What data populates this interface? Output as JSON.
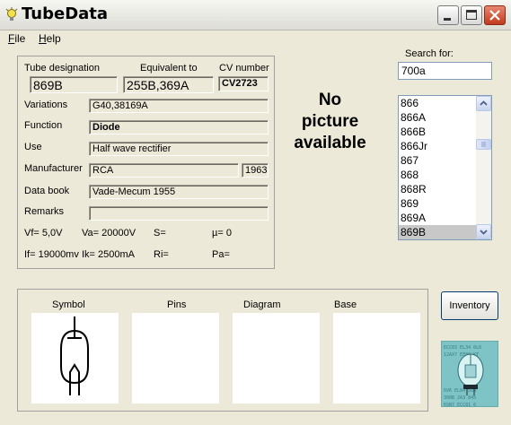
{
  "window": {
    "title": "TubeData"
  },
  "menu": {
    "file": "File",
    "help": "Help"
  },
  "labels": {
    "tube_designation": "Tube designation",
    "equivalent_to": "Equivalent to",
    "cv_number": "CV number",
    "variations": "Variations",
    "function": "Function",
    "use": "Use",
    "manufacturer": "Manufacturer",
    "data_book": "Data book",
    "remarks": "Remarks"
  },
  "fields": {
    "tube_designation": "869B",
    "equivalent_to": "255B,369A",
    "cv_number": "CV2723",
    "variations": "G40,38169A",
    "function": "Diode",
    "use": "Half wave rectifier",
    "manufacturer": "RCA",
    "year": "1963",
    "data_book": "Vade-Mecum 1955",
    "remarks": ""
  },
  "params": {
    "vf": "Vf= 5,0V",
    "va": "Va= 20000V",
    "s": "S=",
    "mu": "µ=   0",
    "if": "If= 19000mv",
    "ik": "Ik=   2500mA",
    "ri": "Ri=",
    "pa": "Pa="
  },
  "picture": {
    "line1": "No",
    "line2": "picture",
    "line3": "available"
  },
  "search": {
    "label": "Search for:",
    "value": "700a"
  },
  "tube_list": {
    "items": [
      "866",
      "866A",
      "866B",
      "866Jr",
      "867",
      "868",
      "868R",
      "869",
      "869A",
      "869B"
    ],
    "selected": "869B"
  },
  "panels": {
    "symbol": "Symbol",
    "pins": "Pins",
    "diagram": "Diagram",
    "base": "Base"
  },
  "buttons": {
    "inventory": "Inventory"
  },
  "icons": {
    "app": "lightbulb-icon",
    "minimize": "minimize-icon",
    "maximize": "maximize-icon",
    "close": "close-icon",
    "scroll_up": "chevron-up-icon",
    "scroll_down": "chevron-down-icon"
  },
  "colors": {
    "close_button": "#c23a1e",
    "list_selection": "#c8c8c8",
    "logo_bg": "#7ec3c6"
  }
}
